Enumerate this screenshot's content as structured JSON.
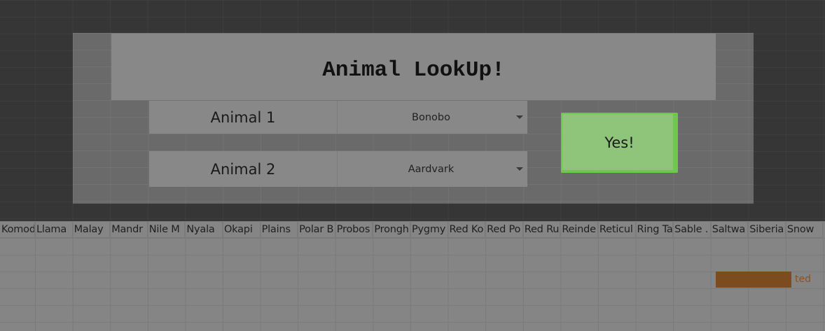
{
  "modal": {
    "title": "Animal LookUp!",
    "rows": [
      {
        "label": "Animal 1",
        "selected": "Bonobo"
      },
      {
        "label": "Animal 2",
        "selected": "Aardvark"
      }
    ],
    "confirm_label": "Yes!"
  },
  "sheet": {
    "headers": [
      "Komod",
      "Llama",
      "Malay",
      "Mandr",
      "Nile M",
      "Nyala",
      "Okapi",
      "Plains",
      "Polar B",
      "Probos",
      "Prongh",
      "Pygmy",
      "Red Ko",
      "Red Po",
      "Red Ru",
      "Reinde",
      "Reticul",
      "Ring Ta",
      "Sable .",
      "Saltwa",
      "Siberia",
      "Snow"
    ],
    "overflow_text": "ted"
  },
  "colors": {
    "background": "#363636",
    "modal_panel": "#888888",
    "confirm_button": "#8fc47b",
    "confirm_border": "#6fc84d",
    "highlight_cell": "#7d4c1e"
  },
  "icons": {
    "dropdown": "caret-down-icon"
  }
}
